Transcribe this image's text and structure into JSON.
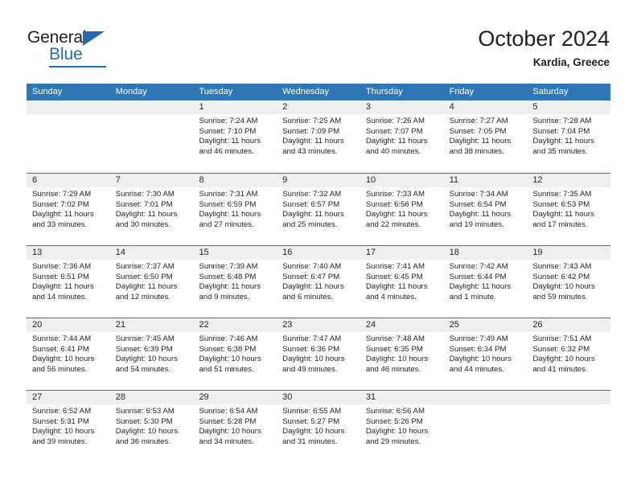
{
  "brand": {
    "name_top": "General",
    "name_bottom": "Blue",
    "accent_color": "#1f6cb0"
  },
  "header": {
    "title": "October 2024",
    "subtitle": "Kardia, Greece",
    "header_bg": "#2e77b6",
    "day_band_bg": "#efefef"
  },
  "weekdays": [
    "Sunday",
    "Monday",
    "Tuesday",
    "Wednesday",
    "Thursday",
    "Friday",
    "Saturday"
  ],
  "weeks": [
    {
      "days": [
        {
          "num": "",
          "empty": true,
          "sunrise": "",
          "sunset": "",
          "daylight": ""
        },
        {
          "num": "",
          "empty": true,
          "sunrise": "",
          "sunset": "",
          "daylight": ""
        },
        {
          "num": "1",
          "empty": false,
          "sunrise": "Sunrise: 7:24 AM",
          "sunset": "Sunset: 7:10 PM",
          "daylight": "Daylight: 11 hours and 46 minutes."
        },
        {
          "num": "2",
          "empty": false,
          "sunrise": "Sunrise: 7:25 AM",
          "sunset": "Sunset: 7:09 PM",
          "daylight": "Daylight: 11 hours and 43 minutes."
        },
        {
          "num": "3",
          "empty": false,
          "sunrise": "Sunrise: 7:26 AM",
          "sunset": "Sunset: 7:07 PM",
          "daylight": "Daylight: 11 hours and 40 minutes."
        },
        {
          "num": "4",
          "empty": false,
          "sunrise": "Sunrise: 7:27 AM",
          "sunset": "Sunset: 7:05 PM",
          "daylight": "Daylight: 11 hours and 38 minutes."
        },
        {
          "num": "5",
          "empty": false,
          "sunrise": "Sunrise: 7:28 AM",
          "sunset": "Sunset: 7:04 PM",
          "daylight": "Daylight: 11 hours and 35 minutes."
        }
      ]
    },
    {
      "days": [
        {
          "num": "6",
          "empty": false,
          "sunrise": "Sunrise: 7:29 AM",
          "sunset": "Sunset: 7:02 PM",
          "daylight": "Daylight: 11 hours and 33 minutes."
        },
        {
          "num": "7",
          "empty": false,
          "sunrise": "Sunrise: 7:30 AM",
          "sunset": "Sunset: 7:01 PM",
          "daylight": "Daylight: 11 hours and 30 minutes."
        },
        {
          "num": "8",
          "empty": false,
          "sunrise": "Sunrise: 7:31 AM",
          "sunset": "Sunset: 6:59 PM",
          "daylight": "Daylight: 11 hours and 27 minutes."
        },
        {
          "num": "9",
          "empty": false,
          "sunrise": "Sunrise: 7:32 AM",
          "sunset": "Sunset: 6:57 PM",
          "daylight": "Daylight: 11 hours and 25 minutes."
        },
        {
          "num": "10",
          "empty": false,
          "sunrise": "Sunrise: 7:33 AM",
          "sunset": "Sunset: 6:56 PM",
          "daylight": "Daylight: 11 hours and 22 minutes."
        },
        {
          "num": "11",
          "empty": false,
          "sunrise": "Sunrise: 7:34 AM",
          "sunset": "Sunset: 6:54 PM",
          "daylight": "Daylight: 11 hours and 19 minutes."
        },
        {
          "num": "12",
          "empty": false,
          "sunrise": "Sunrise: 7:35 AM",
          "sunset": "Sunset: 6:53 PM",
          "daylight": "Daylight: 11 hours and 17 minutes."
        }
      ]
    },
    {
      "days": [
        {
          "num": "13",
          "empty": false,
          "sunrise": "Sunrise: 7:36 AM",
          "sunset": "Sunset: 6:51 PM",
          "daylight": "Daylight: 11 hours and 14 minutes."
        },
        {
          "num": "14",
          "empty": false,
          "sunrise": "Sunrise: 7:37 AM",
          "sunset": "Sunset: 6:50 PM",
          "daylight": "Daylight: 11 hours and 12 minutes."
        },
        {
          "num": "15",
          "empty": false,
          "sunrise": "Sunrise: 7:39 AM",
          "sunset": "Sunset: 6:48 PM",
          "daylight": "Daylight: 11 hours and 9 minutes."
        },
        {
          "num": "16",
          "empty": false,
          "sunrise": "Sunrise: 7:40 AM",
          "sunset": "Sunset: 6:47 PM",
          "daylight": "Daylight: 11 hours and 6 minutes."
        },
        {
          "num": "17",
          "empty": false,
          "sunrise": "Sunrise: 7:41 AM",
          "sunset": "Sunset: 6:45 PM",
          "daylight": "Daylight: 11 hours and 4 minutes."
        },
        {
          "num": "18",
          "empty": false,
          "sunrise": "Sunrise: 7:42 AM",
          "sunset": "Sunset: 6:44 PM",
          "daylight": "Daylight: 11 hours and 1 minute."
        },
        {
          "num": "19",
          "empty": false,
          "sunrise": "Sunrise: 7:43 AM",
          "sunset": "Sunset: 6:42 PM",
          "daylight": "Daylight: 10 hours and 59 minutes."
        }
      ]
    },
    {
      "days": [
        {
          "num": "20",
          "empty": false,
          "sunrise": "Sunrise: 7:44 AM",
          "sunset": "Sunset: 6:41 PM",
          "daylight": "Daylight: 10 hours and 56 minutes."
        },
        {
          "num": "21",
          "empty": false,
          "sunrise": "Sunrise: 7:45 AM",
          "sunset": "Sunset: 6:39 PM",
          "daylight": "Daylight: 10 hours and 54 minutes."
        },
        {
          "num": "22",
          "empty": false,
          "sunrise": "Sunrise: 7:46 AM",
          "sunset": "Sunset: 6:38 PM",
          "daylight": "Daylight: 10 hours and 51 minutes."
        },
        {
          "num": "23",
          "empty": false,
          "sunrise": "Sunrise: 7:47 AM",
          "sunset": "Sunset: 6:36 PM",
          "daylight": "Daylight: 10 hours and 49 minutes."
        },
        {
          "num": "24",
          "empty": false,
          "sunrise": "Sunrise: 7:48 AM",
          "sunset": "Sunset: 6:35 PM",
          "daylight": "Daylight: 10 hours and 46 minutes."
        },
        {
          "num": "25",
          "empty": false,
          "sunrise": "Sunrise: 7:49 AM",
          "sunset": "Sunset: 6:34 PM",
          "daylight": "Daylight: 10 hours and 44 minutes."
        },
        {
          "num": "26",
          "empty": false,
          "sunrise": "Sunrise: 7:51 AM",
          "sunset": "Sunset: 6:32 PM",
          "daylight": "Daylight: 10 hours and 41 minutes."
        }
      ]
    },
    {
      "days": [
        {
          "num": "27",
          "empty": false,
          "sunrise": "Sunrise: 6:52 AM",
          "sunset": "Sunset: 5:31 PM",
          "daylight": "Daylight: 10 hours and 39 minutes."
        },
        {
          "num": "28",
          "empty": false,
          "sunrise": "Sunrise: 6:53 AM",
          "sunset": "Sunset: 5:30 PM",
          "daylight": "Daylight: 10 hours and 36 minutes."
        },
        {
          "num": "29",
          "empty": false,
          "sunrise": "Sunrise: 6:54 AM",
          "sunset": "Sunset: 5:28 PM",
          "daylight": "Daylight: 10 hours and 34 minutes."
        },
        {
          "num": "30",
          "empty": false,
          "sunrise": "Sunrise: 6:55 AM",
          "sunset": "Sunset: 5:27 PM",
          "daylight": "Daylight: 10 hours and 31 minutes."
        },
        {
          "num": "31",
          "empty": false,
          "sunrise": "Sunrise: 6:56 AM",
          "sunset": "Sunset: 5:26 PM",
          "daylight": "Daylight: 10 hours and 29 minutes."
        },
        {
          "num": "",
          "empty": true,
          "sunrise": "",
          "sunset": "",
          "daylight": ""
        },
        {
          "num": "",
          "empty": true,
          "sunrise": "",
          "sunset": "",
          "daylight": ""
        }
      ]
    }
  ]
}
